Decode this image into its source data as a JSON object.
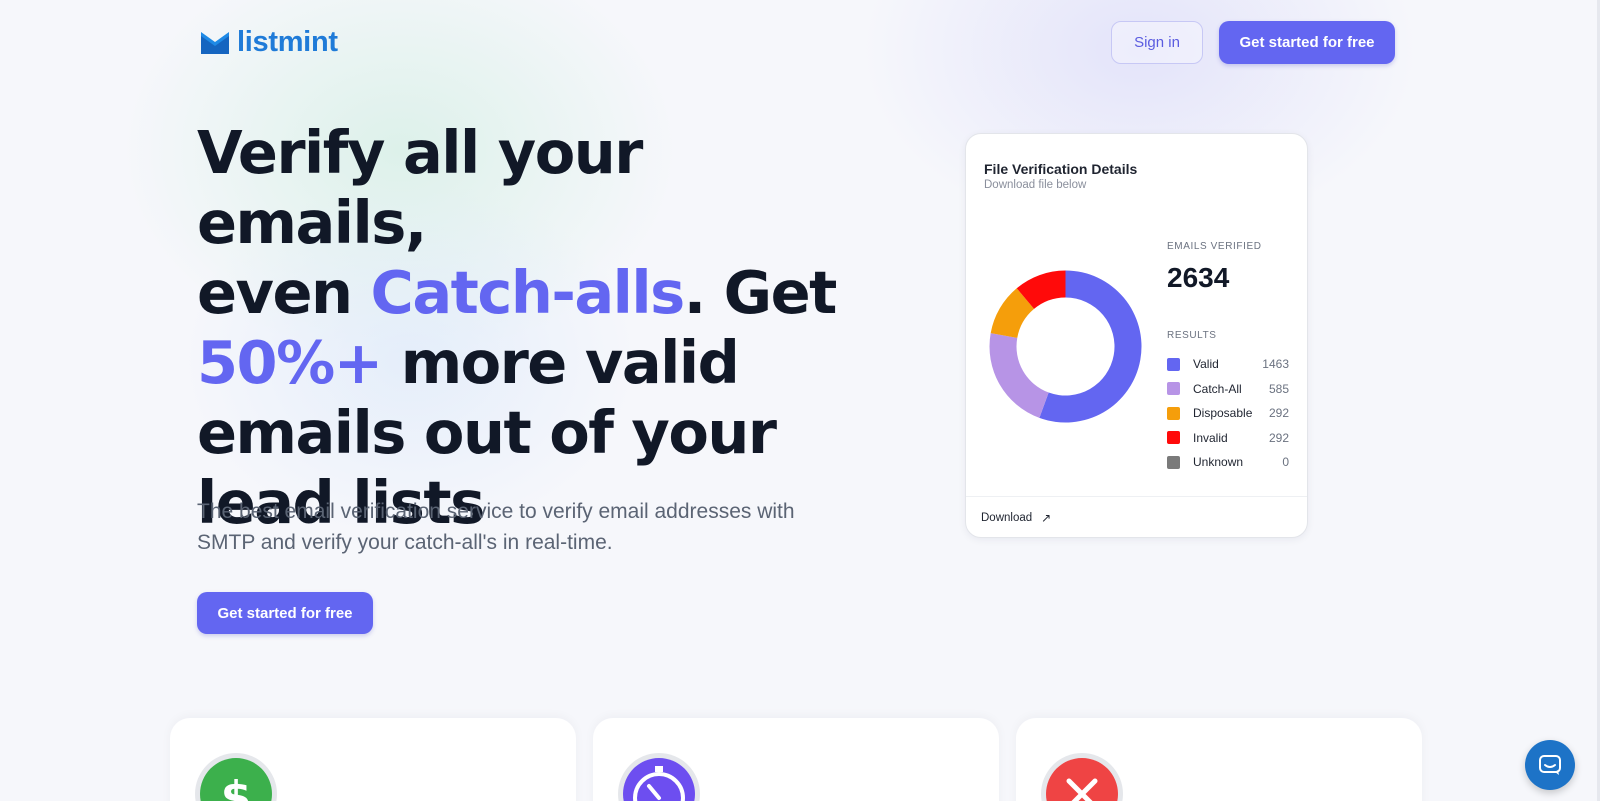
{
  "brand": {
    "name": "listmint",
    "logo_icon": "envelope-icon",
    "color": "#1f7bd8"
  },
  "header": {
    "signin_label": "Sign in",
    "cta_label": "Get started for free"
  },
  "hero": {
    "line1": "Verify all your emails,",
    "line2_a": "even ",
    "line2_accent": "Catch-alls",
    "line2_b": ". Get",
    "line3_accent": " 50%+",
    "line3_b": " more valid",
    "line4": "emails out of your",
    "line5": "lead lists",
    "subtitle": "The best email verification service to verify email addresses with SMTP and verify your catch-all's in real-time.",
    "cta_label": "Get started for free"
  },
  "card": {
    "title": "File Verification Details",
    "subtitle": "Download file below",
    "emails_verified_label": "EMAILS VERIFIED",
    "emails_verified_count": "2634",
    "results_label": "RESULTS",
    "download_label": "Download",
    "download_icon": "arrow-up-right-icon"
  },
  "chart_data": {
    "type": "pie",
    "categories": [
      "Valid",
      "Catch-All",
      "Disposable",
      "Invalid",
      "Unknown"
    ],
    "values": [
      1463,
      585,
      292,
      292,
      0
    ],
    "colors": [
      "#6366f1",
      "#b794e6",
      "#f59e0b",
      "#ff0a0a",
      "#7a7a7a"
    ]
  },
  "features": [
    {
      "icon": "dollar-sign-icon",
      "color": "#3cb04c"
    },
    {
      "icon": "speedometer-icon",
      "color": "#6d4ef0"
    },
    {
      "icon": "x-mark-icon",
      "color": "#ef4444"
    }
  ],
  "accent_color": "#6366f1",
  "chat_icon": "chat-icon"
}
